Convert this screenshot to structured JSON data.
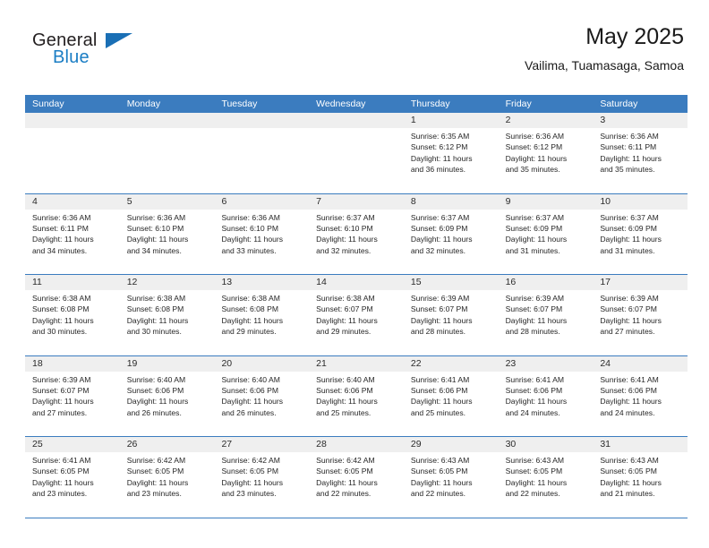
{
  "brand": {
    "word_one": "General",
    "word_two": "Blue",
    "flag_icon": "triangle-flag-icon",
    "accent_color": "#1a7dc4"
  },
  "header": {
    "title": "May 2025",
    "subtitle": "Vailima, Tuamasaga, Samoa"
  },
  "theme": {
    "header_blue": "#3b7cbf",
    "date_strip": "#efefef",
    "text": "#262626"
  },
  "calendar": {
    "weekday_headers": [
      "Sunday",
      "Monday",
      "Tuesday",
      "Wednesday",
      "Thursday",
      "Friday",
      "Saturday"
    ],
    "weeks": [
      [
        {
          "date": "",
          "lines": []
        },
        {
          "date": "",
          "lines": []
        },
        {
          "date": "",
          "lines": []
        },
        {
          "date": "",
          "lines": []
        },
        {
          "date": "1",
          "lines": [
            "Sunrise: 6:35 AM",
            "Sunset: 6:12 PM",
            "Daylight: 11 hours",
            "and 36 minutes."
          ]
        },
        {
          "date": "2",
          "lines": [
            "Sunrise: 6:36 AM",
            "Sunset: 6:12 PM",
            "Daylight: 11 hours",
            "and 35 minutes."
          ]
        },
        {
          "date": "3",
          "lines": [
            "Sunrise: 6:36 AM",
            "Sunset: 6:11 PM",
            "Daylight: 11 hours",
            "and 35 minutes."
          ]
        }
      ],
      [
        {
          "date": "4",
          "lines": [
            "Sunrise: 6:36 AM",
            "Sunset: 6:11 PM",
            "Daylight: 11 hours",
            "and 34 minutes."
          ]
        },
        {
          "date": "5",
          "lines": [
            "Sunrise: 6:36 AM",
            "Sunset: 6:10 PM",
            "Daylight: 11 hours",
            "and 34 minutes."
          ]
        },
        {
          "date": "6",
          "lines": [
            "Sunrise: 6:36 AM",
            "Sunset: 6:10 PM",
            "Daylight: 11 hours",
            "and 33 minutes."
          ]
        },
        {
          "date": "7",
          "lines": [
            "Sunrise: 6:37 AM",
            "Sunset: 6:10 PM",
            "Daylight: 11 hours",
            "and 32 minutes."
          ]
        },
        {
          "date": "8",
          "lines": [
            "Sunrise: 6:37 AM",
            "Sunset: 6:09 PM",
            "Daylight: 11 hours",
            "and 32 minutes."
          ]
        },
        {
          "date": "9",
          "lines": [
            "Sunrise: 6:37 AM",
            "Sunset: 6:09 PM",
            "Daylight: 11 hours",
            "and 31 minutes."
          ]
        },
        {
          "date": "10",
          "lines": [
            "Sunrise: 6:37 AM",
            "Sunset: 6:09 PM",
            "Daylight: 11 hours",
            "and 31 minutes."
          ]
        }
      ],
      [
        {
          "date": "11",
          "lines": [
            "Sunrise: 6:38 AM",
            "Sunset: 6:08 PM",
            "Daylight: 11 hours",
            "and 30 minutes."
          ]
        },
        {
          "date": "12",
          "lines": [
            "Sunrise: 6:38 AM",
            "Sunset: 6:08 PM",
            "Daylight: 11 hours",
            "and 30 minutes."
          ]
        },
        {
          "date": "13",
          "lines": [
            "Sunrise: 6:38 AM",
            "Sunset: 6:08 PM",
            "Daylight: 11 hours",
            "and 29 minutes."
          ]
        },
        {
          "date": "14",
          "lines": [
            "Sunrise: 6:38 AM",
            "Sunset: 6:07 PM",
            "Daylight: 11 hours",
            "and 29 minutes."
          ]
        },
        {
          "date": "15",
          "lines": [
            "Sunrise: 6:39 AM",
            "Sunset: 6:07 PM",
            "Daylight: 11 hours",
            "and 28 minutes."
          ]
        },
        {
          "date": "16",
          "lines": [
            "Sunrise: 6:39 AM",
            "Sunset: 6:07 PM",
            "Daylight: 11 hours",
            "and 28 minutes."
          ]
        },
        {
          "date": "17",
          "lines": [
            "Sunrise: 6:39 AM",
            "Sunset: 6:07 PM",
            "Daylight: 11 hours",
            "and 27 minutes."
          ]
        }
      ],
      [
        {
          "date": "18",
          "lines": [
            "Sunrise: 6:39 AM",
            "Sunset: 6:07 PM",
            "Daylight: 11 hours",
            "and 27 minutes."
          ]
        },
        {
          "date": "19",
          "lines": [
            "Sunrise: 6:40 AM",
            "Sunset: 6:06 PM",
            "Daylight: 11 hours",
            "and 26 minutes."
          ]
        },
        {
          "date": "20",
          "lines": [
            "Sunrise: 6:40 AM",
            "Sunset: 6:06 PM",
            "Daylight: 11 hours",
            "and 26 minutes."
          ]
        },
        {
          "date": "21",
          "lines": [
            "Sunrise: 6:40 AM",
            "Sunset: 6:06 PM",
            "Daylight: 11 hours",
            "and 25 minutes."
          ]
        },
        {
          "date": "22",
          "lines": [
            "Sunrise: 6:41 AM",
            "Sunset: 6:06 PM",
            "Daylight: 11 hours",
            "and 25 minutes."
          ]
        },
        {
          "date": "23",
          "lines": [
            "Sunrise: 6:41 AM",
            "Sunset: 6:06 PM",
            "Daylight: 11 hours",
            "and 24 minutes."
          ]
        },
        {
          "date": "24",
          "lines": [
            "Sunrise: 6:41 AM",
            "Sunset: 6:06 PM",
            "Daylight: 11 hours",
            "and 24 minutes."
          ]
        }
      ],
      [
        {
          "date": "25",
          "lines": [
            "Sunrise: 6:41 AM",
            "Sunset: 6:05 PM",
            "Daylight: 11 hours",
            "and 23 minutes."
          ]
        },
        {
          "date": "26",
          "lines": [
            "Sunrise: 6:42 AM",
            "Sunset: 6:05 PM",
            "Daylight: 11 hours",
            "and 23 minutes."
          ]
        },
        {
          "date": "27",
          "lines": [
            "Sunrise: 6:42 AM",
            "Sunset: 6:05 PM",
            "Daylight: 11 hours",
            "and 23 minutes."
          ]
        },
        {
          "date": "28",
          "lines": [
            "Sunrise: 6:42 AM",
            "Sunset: 6:05 PM",
            "Daylight: 11 hours",
            "and 22 minutes."
          ]
        },
        {
          "date": "29",
          "lines": [
            "Sunrise: 6:43 AM",
            "Sunset: 6:05 PM",
            "Daylight: 11 hours",
            "and 22 minutes."
          ]
        },
        {
          "date": "30",
          "lines": [
            "Sunrise: 6:43 AM",
            "Sunset: 6:05 PM",
            "Daylight: 11 hours",
            "and 22 minutes."
          ]
        },
        {
          "date": "31",
          "lines": [
            "Sunrise: 6:43 AM",
            "Sunset: 6:05 PM",
            "Daylight: 11 hours",
            "and 21 minutes."
          ]
        }
      ]
    ]
  }
}
